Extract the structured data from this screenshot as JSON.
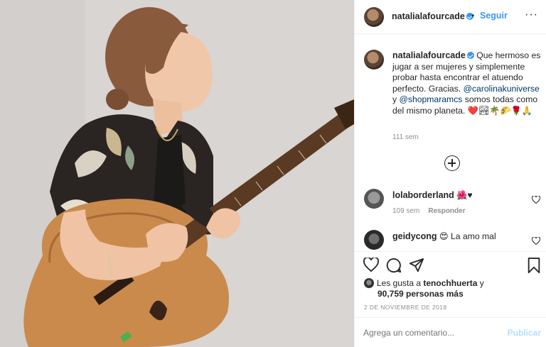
{
  "post": {
    "username": "natalialafourcade",
    "separator": "•",
    "follow_label": "Seguir",
    "more_label": "···",
    "caption_part1": "Que hermoso es jugar a ser mujeres y simplemente probar hasta encontrar el atuendo perfecto. Gracias.",
    "mention1": "@carolinakuniverse",
    "connector": " y ",
    "mention2": "@shopmaramcs",
    "caption_part2": " somos todas como del mismo planeta. ❤️🏞🌴🌮🌹🙏",
    "caption_time": "111 sem",
    "likes_prefix": "Les gusta a ",
    "likes_user": "tenochhuerta",
    "likes_suffix": " y",
    "likes_count": "90,759 personas más",
    "date": "2 DE NOVIEMBRE DE 2018",
    "comment_placeholder": "Agrega un comentario...",
    "publish_label": "Publicar"
  },
  "comments": [
    {
      "username": "lolaborderland",
      "text": "🌺♥",
      "time": "109 sem",
      "reply_label": "Responder"
    },
    {
      "username": "geidycong",
      "text": "😍 La amo mal"
    }
  ],
  "icons": {
    "heart": "heart-icon",
    "comment": "comment-icon",
    "share": "share-icon",
    "save": "bookmark-icon",
    "load_more": "plus-circle-icon"
  },
  "colors": {
    "link_blue": "#3897f0",
    "mention_blue": "#003569",
    "muted_gray": "#8e8e8e",
    "publish_disabled": "#b2dffc"
  }
}
